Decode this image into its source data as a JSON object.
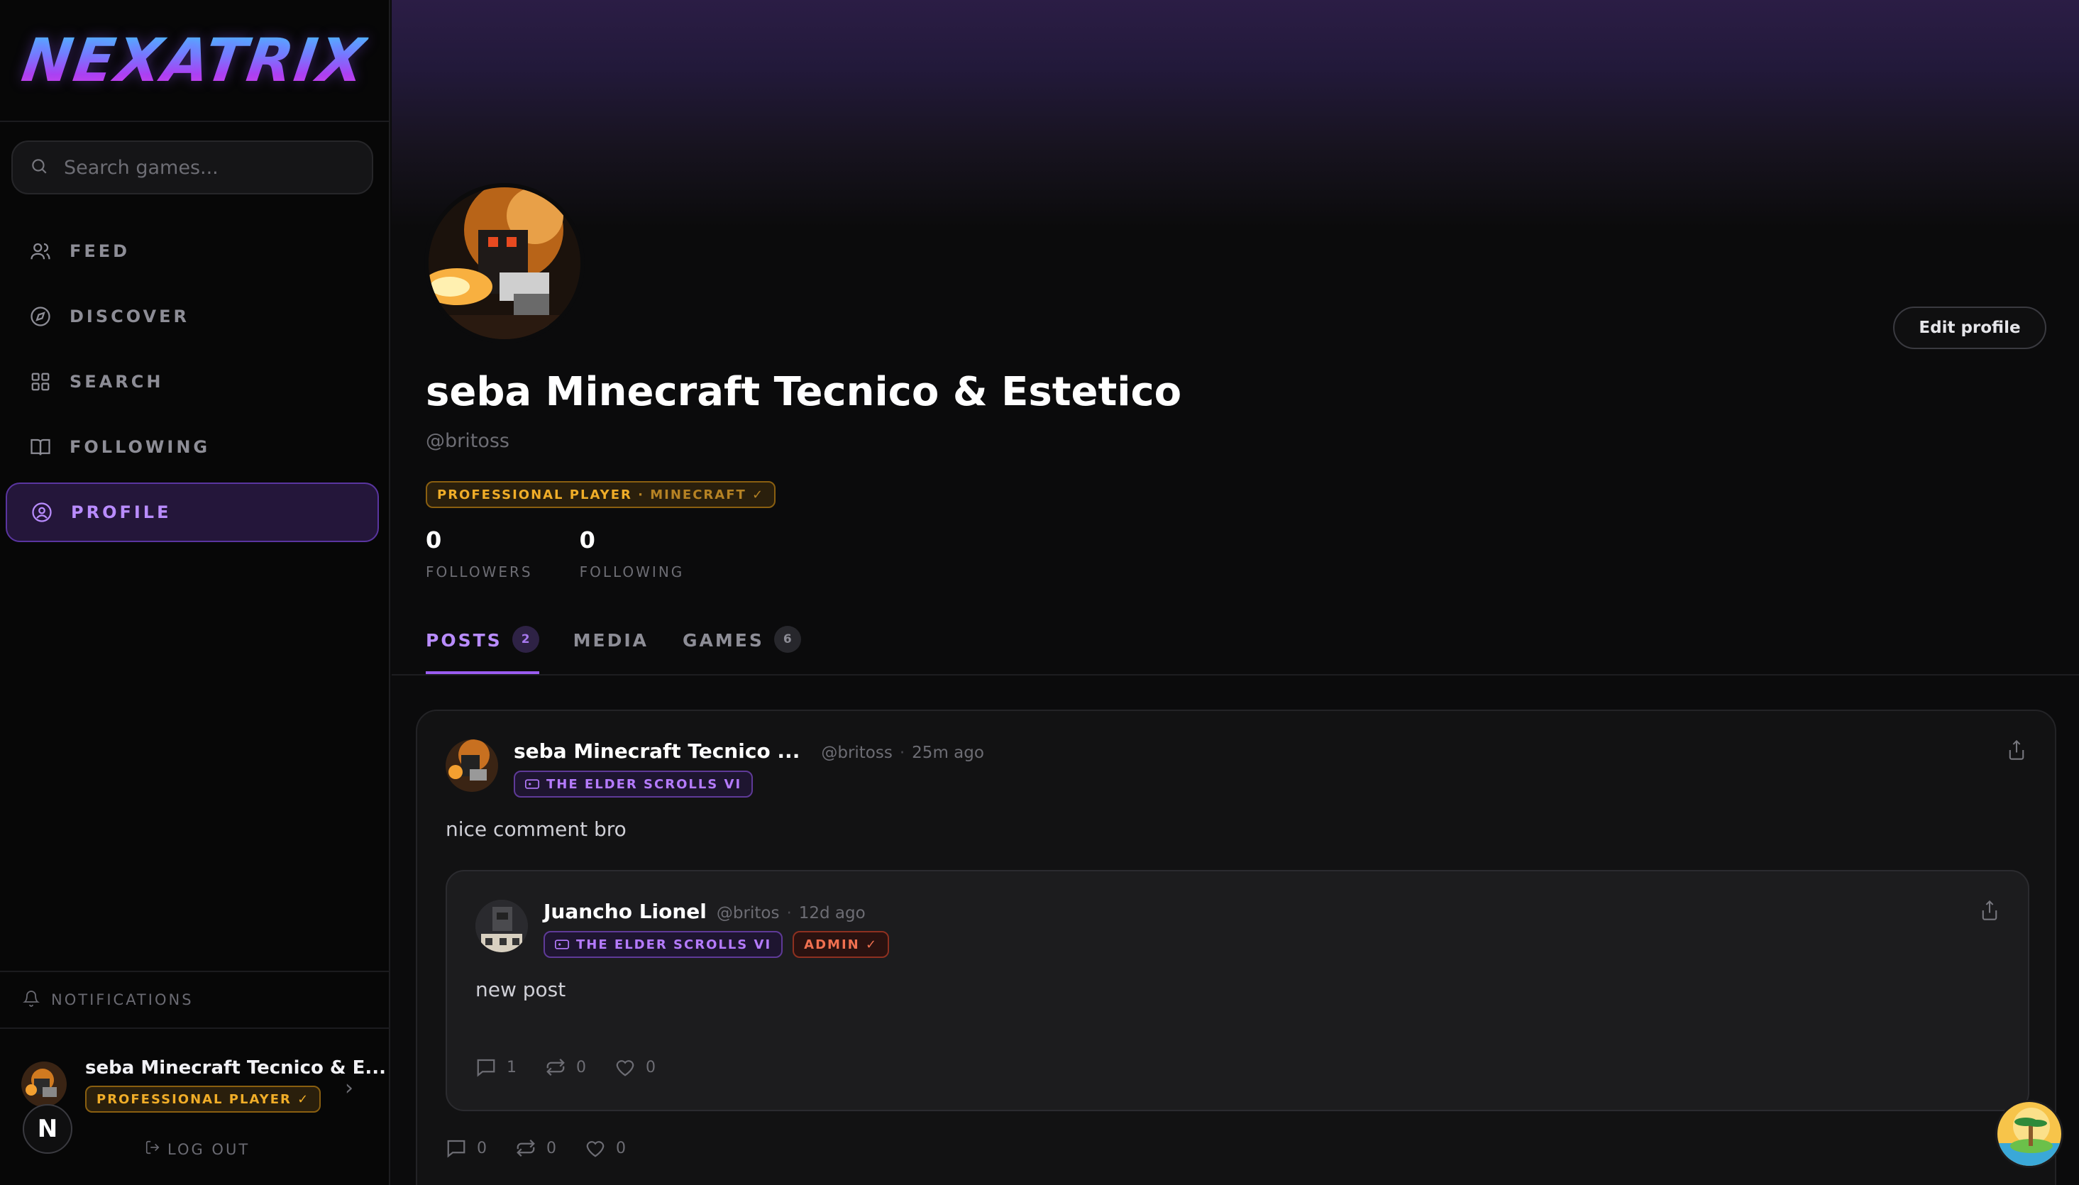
{
  "brand": {
    "logo_text": "NEXATRIX"
  },
  "search": {
    "placeholder": "Search games..."
  },
  "sidebar": {
    "items": [
      {
        "label": "FEED",
        "icon": "users-icon"
      },
      {
        "label": "DISCOVER",
        "icon": "compass-icon"
      },
      {
        "label": "SEARCH",
        "icon": "grid-icon"
      },
      {
        "label": "FOLLOWING",
        "icon": "book-icon"
      },
      {
        "label": "PROFILE",
        "icon": "user-circle-icon",
        "active": true
      }
    ],
    "notifications_label": "NOTIFICATIONS",
    "user": {
      "name": "seba Minecraft Tecnico & E...",
      "badge": "PROFESSIONAL PLAYER ✓"
    },
    "n_badge": "N",
    "logout_label": "LOG OUT"
  },
  "profile": {
    "display_name": "seba Minecraft Tecnico & Estetico",
    "handle": "@britoss",
    "badge_role": "PROFESSIONAL PLAYER",
    "badge_game": "· MINECRAFT ✓",
    "edit_label": "Edit profile",
    "stats": [
      {
        "value": "0",
        "label": "FOLLOWERS"
      },
      {
        "value": "0",
        "label": "FOLLOWING"
      }
    ]
  },
  "tabs": [
    {
      "label": "POSTS",
      "count": "2",
      "active": true
    },
    {
      "label": "MEDIA",
      "count": ""
    },
    {
      "label": "GAMES",
      "count": "6"
    }
  ],
  "post": {
    "author": "seba Minecraft Tecnico ...",
    "handle": "@britoss",
    "time": "25m ago",
    "game_tag": "THE ELDER SCROLLS VI",
    "text": "nice comment bro",
    "comments": "0",
    "reposts": "0",
    "likes": "0",
    "quote": {
      "author": "Juancho Lionel",
      "handle": "@britos",
      "time": "12d ago",
      "game_tag": "THE ELDER SCROLLS VI",
      "role_tag": "ADMIN ✓",
      "text": "new post",
      "comments": "1",
      "reposts": "0",
      "likes": "0"
    }
  },
  "colors": {
    "accent": "#9a5cf0",
    "gold": "#f0ad28",
    "admin": "#f07050",
    "background": "#0b0b0c"
  }
}
